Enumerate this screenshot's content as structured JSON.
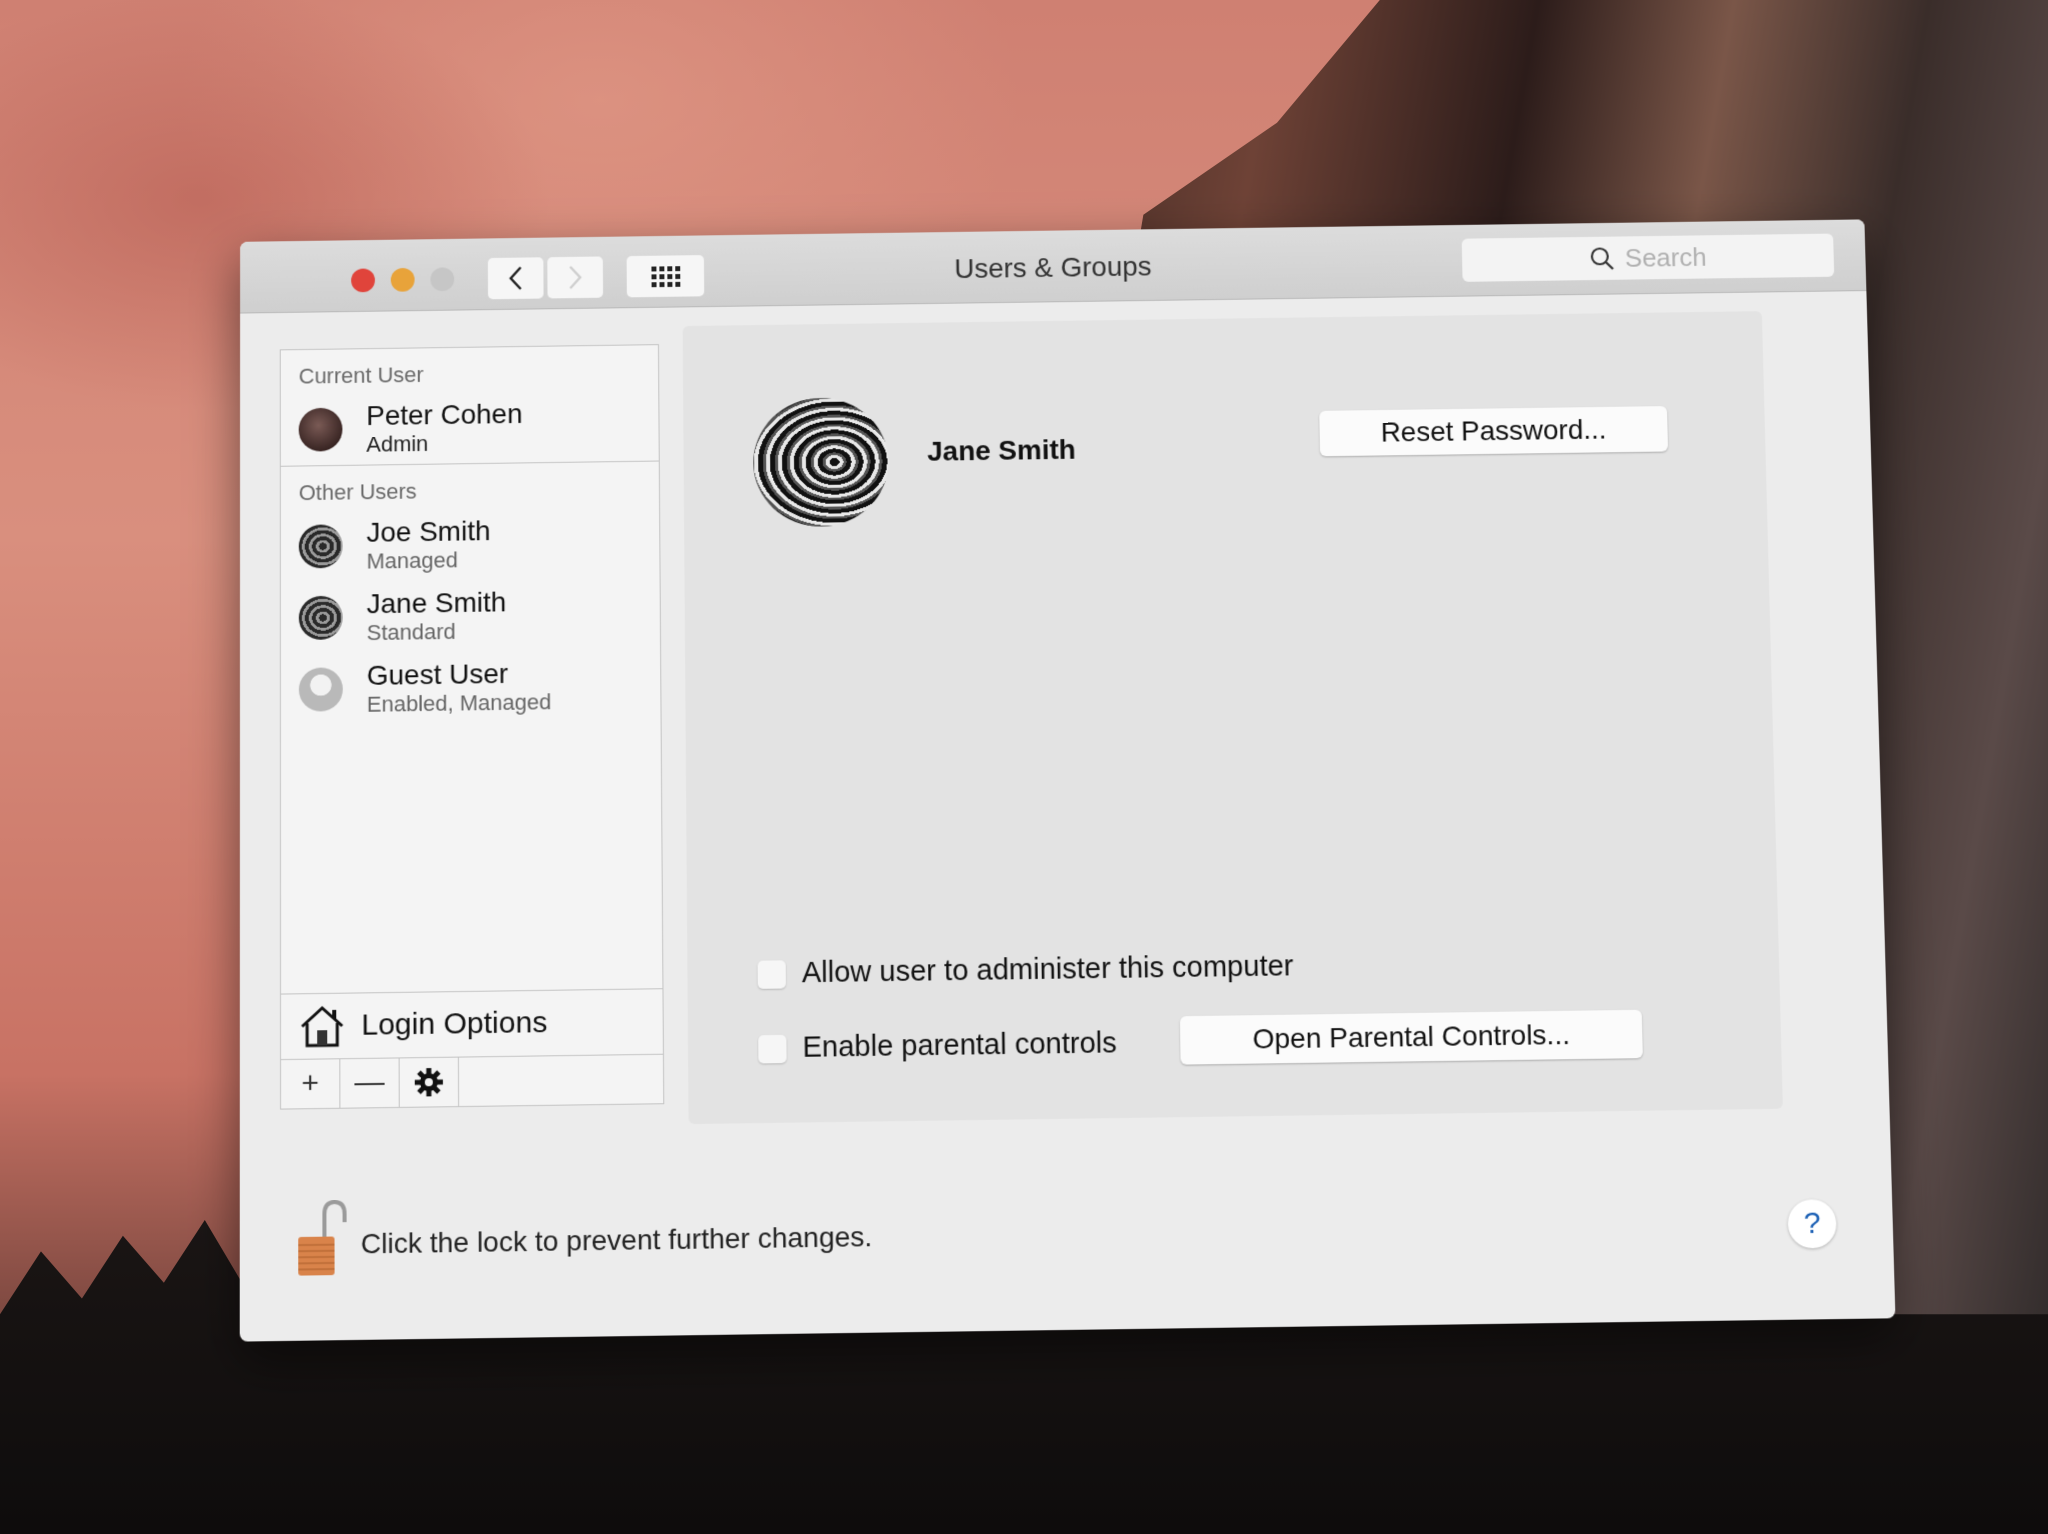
{
  "window": {
    "title": "Users & Groups",
    "search_placeholder": "Search",
    "icons": {
      "close": "traffic-light-close",
      "minimize": "traffic-light-minimize",
      "zoom": "traffic-light-zoom",
      "back": "chevron-left",
      "forward": "chevron-right",
      "show_all": "grid-dots",
      "search": "magnifier"
    },
    "colors": {
      "close": "#e0443b",
      "minimize": "#e8a33a",
      "zoom": "#c6c6c6"
    }
  },
  "sidebar": {
    "current_user_label": "Current User",
    "current_user": {
      "name": "Peter Cohen",
      "role": "Admin"
    },
    "other_users_label": "Other Users",
    "other_users": [
      {
        "name": "Joe Smith",
        "role": "Managed"
      },
      {
        "name": "Jane Smith",
        "role": "Standard"
      },
      {
        "name": "Guest User",
        "role": "Enabled, Managed"
      }
    ],
    "login_options_label": "Login Options",
    "toolbar": {
      "add": "+",
      "remove": "—",
      "actions": "gear"
    }
  },
  "detail": {
    "selected_user_name": "Jane Smith",
    "reset_password_label": "Reset Password...",
    "allow_admin_label": "Allow user to administer this computer",
    "allow_admin_checked": false,
    "parental_controls_label": "Enable parental controls",
    "parental_controls_checked": false,
    "open_parental_controls_label": "Open Parental Controls..."
  },
  "footer": {
    "lock_text": "Click the lock to prevent further changes.",
    "lock_state": "unlocked",
    "help_label": "?"
  }
}
